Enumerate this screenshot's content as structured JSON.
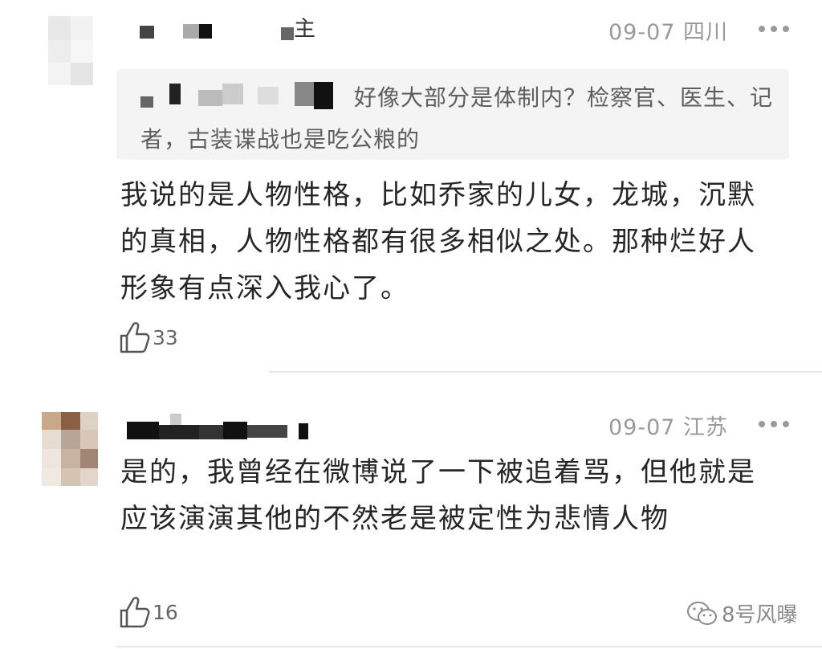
{
  "comments": [
    {
      "owner_tag": "主",
      "meta": "09-07 四川",
      "quote": "好像大部分是体制内？检察官、医生、记者，古装谍战也是吃公粮的",
      "body": "我说的是人物性格，比如乔家的儿女，龙城，沉默的真相，人物性格都有很多相似之处。那种烂好人形象有点深入我心了。",
      "likes": "33"
    },
    {
      "meta": "09-07 江苏",
      "body": "是的，我曾经在微博说了一下被追着骂，但他就是应该演演其他的不然老是被定性为悲情人物",
      "likes": "16"
    }
  ],
  "watermark": "8号风曝",
  "icons": {
    "like": "thumbs-up-icon",
    "more": "more-dots-icon",
    "watermark": "wechat-logo-icon"
  },
  "colors": {
    "meta_text": "#9a9a9a",
    "quote_bg": "#f4f4f4",
    "body_text": "#262626"
  }
}
